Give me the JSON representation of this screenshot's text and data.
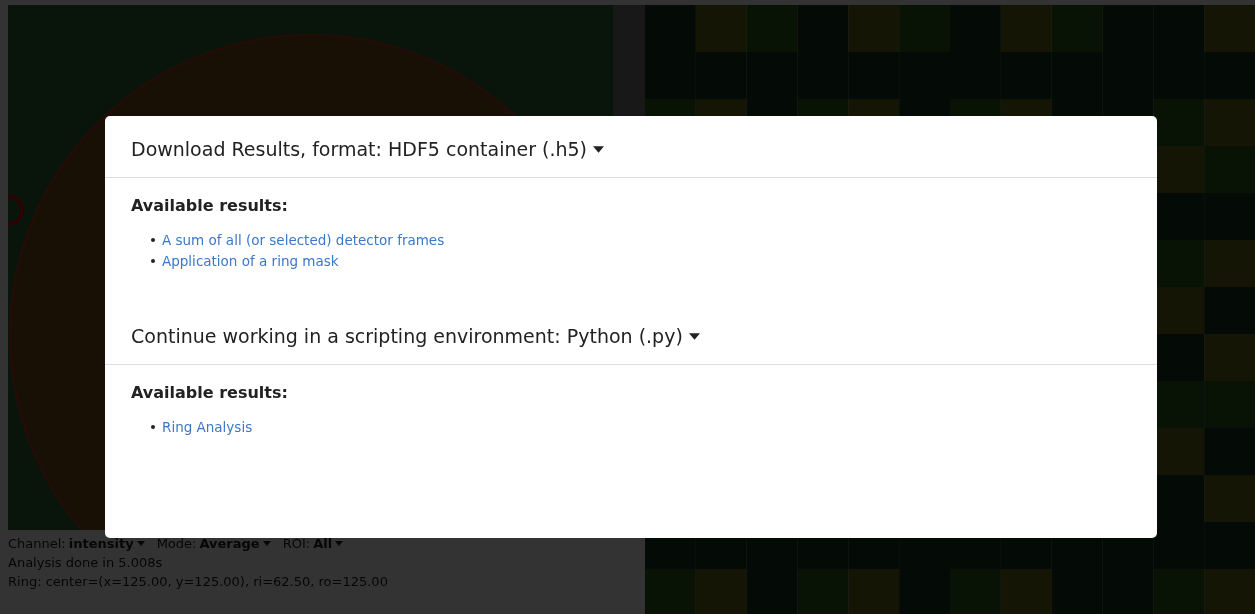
{
  "background": {
    "controls": [
      {
        "label": "Channel:",
        "value": "intensity"
      },
      {
        "label": "Mode:",
        "value": "Average"
      },
      {
        "label": "ROI:",
        "value": "All"
      }
    ],
    "status_lines": [
      "Analysis done in 5.008s",
      "Ring: center=(x=125.00, y=125.00), ri=62.50, ro=125.00"
    ]
  },
  "dialog": {
    "sections": [
      {
        "title": "Download Results, format: HDF5 container (.h5)",
        "subtitle": "Available results:",
        "links": [
          "A sum of all (or selected) detector frames",
          "Application of a ring mask"
        ]
      },
      {
        "title": "Continue working in a scripting environment: Python (.py)",
        "subtitle": "Available results:",
        "links": [
          "Ring Analysis"
        ]
      }
    ]
  }
}
